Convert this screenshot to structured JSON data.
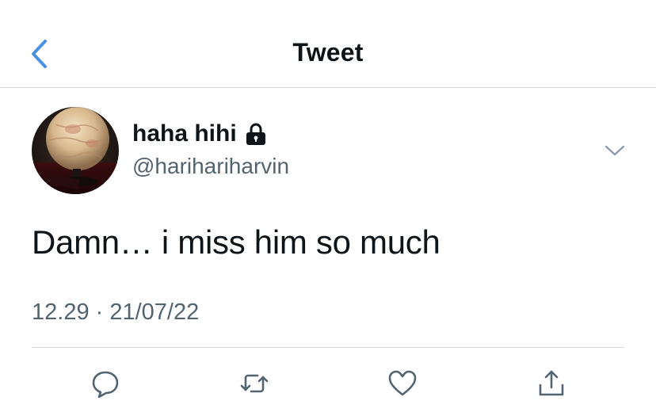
{
  "header": {
    "title": "Tweet",
    "back_icon": "chevron-left-icon",
    "accent_color": "#4a90e2"
  },
  "author": {
    "display_name": "haha hihi",
    "handle": "@harihariharvin",
    "protected_icon": "lock-icon",
    "menu_icon": "chevron-down-icon"
  },
  "tweet": {
    "text": "Damn… i miss him so much",
    "timestamp": "12.29 · 21/07/22"
  },
  "actions": [
    {
      "name": "reply",
      "icon": "reply-icon"
    },
    {
      "name": "retweet",
      "icon": "retweet-icon"
    },
    {
      "name": "like",
      "icon": "heart-icon"
    },
    {
      "name": "share",
      "icon": "share-icon"
    }
  ],
  "colors": {
    "text_primary": "#0f1419",
    "text_secondary": "#536471",
    "divider": "#d6d9dc",
    "icon_gray": "#536471"
  }
}
